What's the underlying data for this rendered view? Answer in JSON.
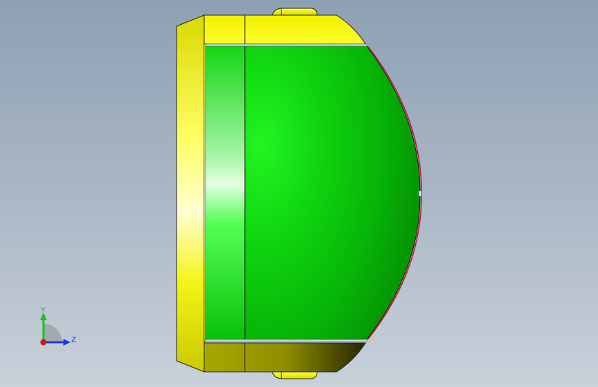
{
  "view": {
    "background_top": "#8ea0b4",
    "background_bottom": "#c9d1da"
  },
  "model": {
    "housing_color": "#f2f20a",
    "lens_color": "#0dbd0d",
    "edge_color": "#111111",
    "accent_edge_color": "#c0182a"
  },
  "triad": {
    "y_label": "Y",
    "z_label": "Z",
    "y_color": "#19c419",
    "z_color": "#1a3ad6",
    "x_color": "#d01818"
  }
}
